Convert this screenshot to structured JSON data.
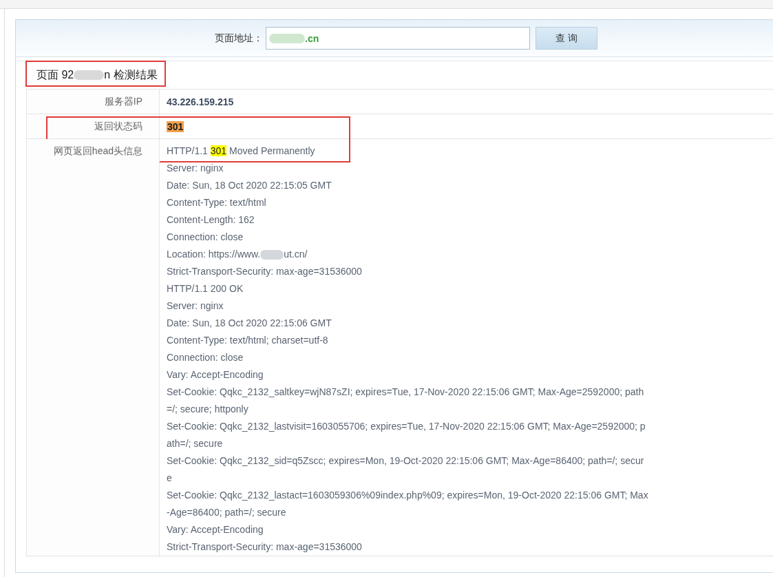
{
  "search": {
    "label": "页面地址：",
    "address": {
      "value": ".cn",
      "redacted": true
    },
    "button": "查 询"
  },
  "result": {
    "title": {
      "before": "页面 92",
      "after": "n 检测结果",
      "redacted": true,
      "framed": true
    },
    "rows": [
      {
        "kind": "ip",
        "label": "服务器IP",
        "value": "43.226.159.215",
        "framed": false
      },
      {
        "kind": "status_code",
        "label": "返回状态码",
        "value": "301",
        "framed": true
      },
      {
        "kind": "headers",
        "label": "网页返回head头信息",
        "framed": true,
        "lines": [
          {
            "kind": "status",
            "protocol": "HTTP/1.1",
            "code": "301",
            "reason": "Moved Permanently",
            "highlighted": true
          },
          {
            "kind": "field",
            "text": "Server: nginx"
          },
          {
            "kind": "field",
            "text": "Date: Sun, 18 Oct 2020 22:15:05 GMT"
          },
          {
            "kind": "field",
            "text": "Content-Type: text/html"
          },
          {
            "kind": "field",
            "text": "Content-Length: 162"
          },
          {
            "kind": "field",
            "text": "Connection: close"
          },
          {
            "kind": "redacted",
            "before": "Location: https://www.",
            "after": "ut.cn/"
          },
          {
            "kind": "field",
            "text": "Strict-Transport-Security: max-age=31536000"
          },
          {
            "kind": "status",
            "protocol": "HTTP/1.1",
            "code": "200",
            "reason": "OK",
            "highlighted": false
          },
          {
            "kind": "field",
            "text": "Server: nginx"
          },
          {
            "kind": "field",
            "text": "Date: Sun, 18 Oct 2020 22:15:06 GMT"
          },
          {
            "kind": "field",
            "text": "Content-Type: text/html; charset=utf-8"
          },
          {
            "kind": "field",
            "text": "Connection: close"
          },
          {
            "kind": "field",
            "text": "Vary: Accept-Encoding"
          },
          {
            "kind": "field",
            "text": "Set-Cookie: Qqkc_2132_saltkey=wjN87sZI; expires=Tue, 17-Nov-2020 22:15:06 GMT; Max-Age=2592000; path=/; secure; httponly"
          },
          {
            "kind": "field",
            "text": "Set-Cookie: Qqkc_2132_lastvisit=1603055706; expires=Tue, 17-Nov-2020 22:15:06 GMT; Max-Age=2592000; path=/; secure"
          },
          {
            "kind": "field",
            "text": "Set-Cookie: Qqkc_2132_sid=q5Zscc; expires=Mon, 19-Oct-2020 22:15:06 GMT; Max-Age=86400; path=/; secure"
          },
          {
            "kind": "field",
            "text": "Set-Cookie: Qqkc_2132_lastact=1603059306%09index.php%09; expires=Mon, 19-Oct-2020 22:15:06 GMT; Max-Age=86400; path=/; secure"
          },
          {
            "kind": "field",
            "text": "Vary: Accept-Encoding"
          },
          {
            "kind": "field",
            "text": "Strict-Transport-Security: max-age=31536000"
          }
        ]
      }
    ]
  }
}
